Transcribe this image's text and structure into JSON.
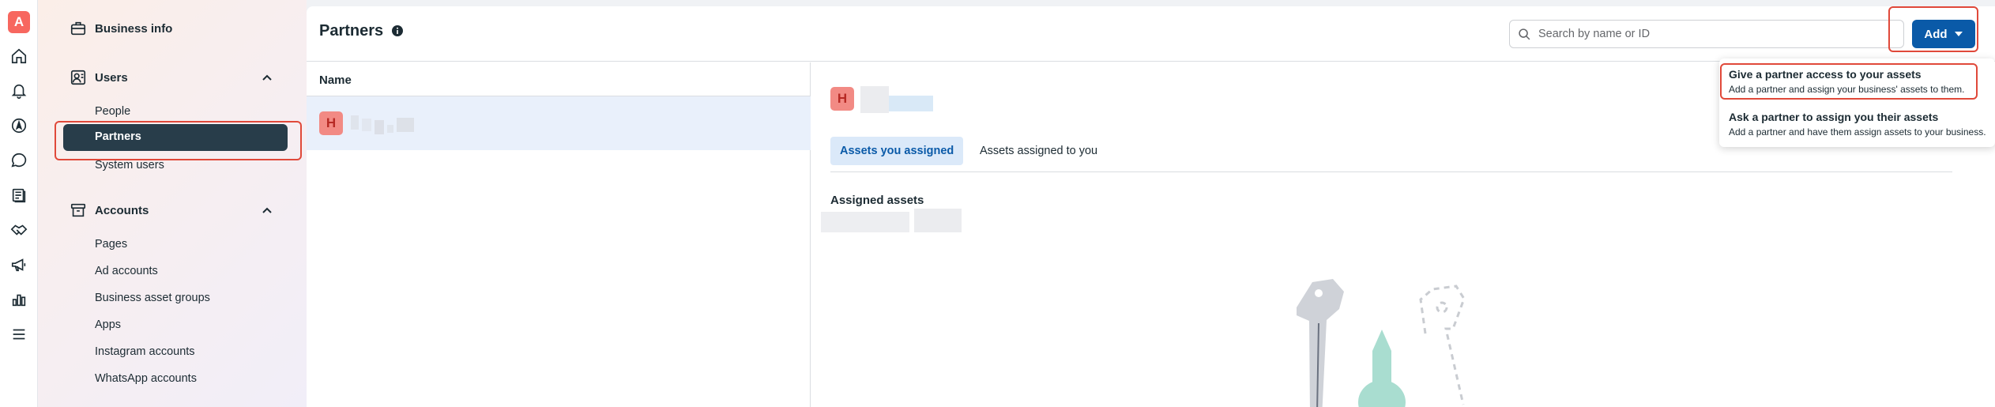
{
  "rail": {
    "logo_letter": "A",
    "icons": [
      "home-icon",
      "bell-icon",
      "compass-icon",
      "chat-icon",
      "pages-icon",
      "handshake-icon",
      "megaphone-icon",
      "bar-chart-icon",
      "menu-icon"
    ]
  },
  "sidebar": {
    "business_info": "Business info",
    "users_section": {
      "label": "Users",
      "items": [
        "People",
        "Partners",
        "System users"
      ],
      "active": "Partners"
    },
    "accounts_section": {
      "label": "Accounts",
      "items": [
        "Pages",
        "Ad accounts",
        "Business asset groups",
        "Apps",
        "Instagram accounts",
        "WhatsApp accounts"
      ]
    }
  },
  "header": {
    "title": "Partners",
    "search_placeholder": "Search by name or ID",
    "add_label": "Add"
  },
  "list": {
    "column_name": "Name",
    "rows": [
      {
        "avatar_letter": "H"
      }
    ]
  },
  "detail": {
    "avatar_letter": "H",
    "tabs": [
      "Assets you assigned",
      "Assets assigned to you"
    ],
    "active_tab": "Assets you assigned",
    "assigned_title": "Assigned assets"
  },
  "dropdown": {
    "items": [
      {
        "title": "Give a partner access to your assets",
        "description": "Add a partner and assign your business' assets to them."
      },
      {
        "title": "Ask a partner to assign you their assets",
        "description": "Add a partner and have them assign assets to your business."
      }
    ]
  },
  "colors": {
    "accent": "#0a5aa8",
    "highlight_box": "#e0493a",
    "active_nav": "#283d4a",
    "avatar": "#f28a84"
  }
}
